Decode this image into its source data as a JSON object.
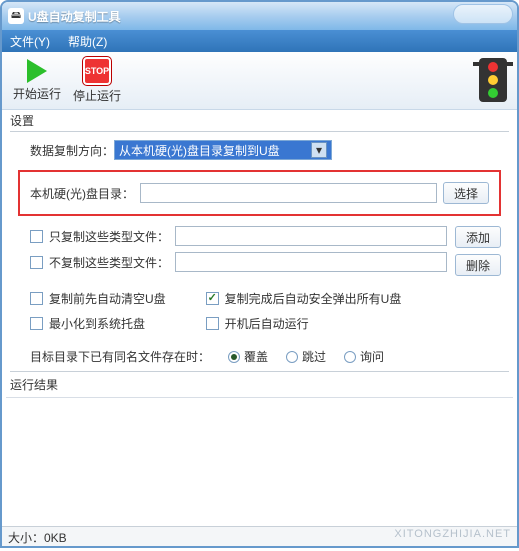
{
  "window": {
    "title": "U盘自动复制工具"
  },
  "menu": {
    "file": "文件(Y)",
    "help": "帮助(Z)"
  },
  "toolbar": {
    "start": "开始运行",
    "stop": "停止运行",
    "stop_icon_text": "STOP"
  },
  "settings": {
    "group_label": "设置",
    "direction_label": "数据复制方向：",
    "direction_value": "从本机硬(光)盘目录复制到U盘",
    "local_dir_label": "本机硬(光)盘目录：",
    "local_dir_value": "",
    "select_btn": "选择",
    "only_copy_label": "只复制这些类型文件：",
    "only_copy_value": "",
    "not_copy_label": "不复制这些类型文件：",
    "not_copy_value": "",
    "add_btn": "添加",
    "delete_btn": "删除",
    "clear_before_label": "复制前先自动清空U盘",
    "eject_after_label": "复制完成后自动安全弹出所有U盘",
    "minimize_tray_label": "最小化到系统托盘",
    "autorun_label": "开机后自动运行",
    "duplicate_label": "目标目录下已有同名文件存在时：",
    "radio_overwrite": "覆盖",
    "radio_skip": "跳过",
    "radio_ask": "询问"
  },
  "results": {
    "label": "运行结果"
  },
  "status": {
    "size": "大小：0KB"
  },
  "watermark": "XITONGZHIJIA.NET"
}
